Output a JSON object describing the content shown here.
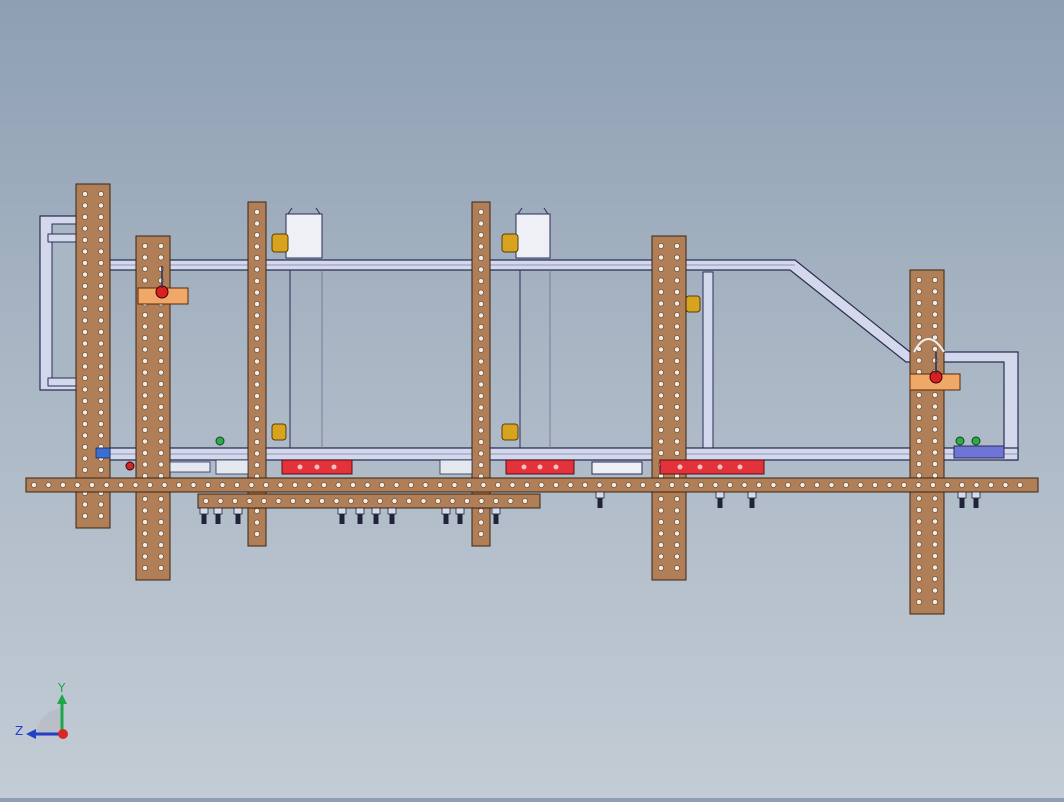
{
  "triad": {
    "y_label": "Y",
    "z_label": "Z"
  },
  "colors": {
    "bar_fill": "#b07f57",
    "bar_stroke": "#3a2414",
    "hole_fill": "#f2ece6",
    "frame_fill": "#d4d8ec",
    "frame_stroke": "#2a2e55",
    "block_red": "#e3323b",
    "clamp_gold": "#d8a31e",
    "axis_y": "#1fa64a",
    "axis_z": "#2340c8",
    "axis_x": "#d92626"
  }
}
